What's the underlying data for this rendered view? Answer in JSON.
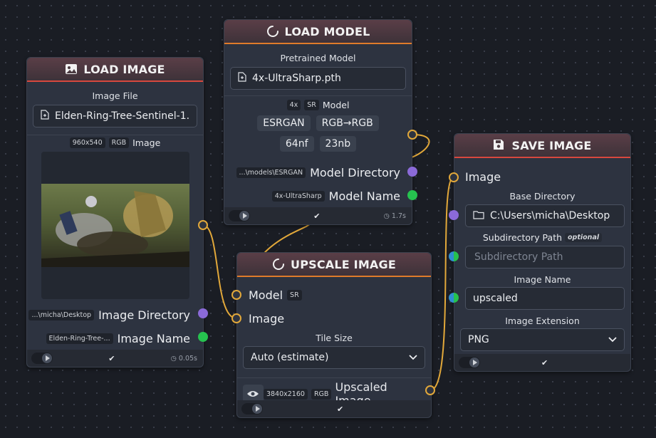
{
  "colors": {
    "canvas_bg": "#1a1d24",
    "node_bg": "#2d3340",
    "header_accent_red": "#d8483e",
    "header_accent_orange": "#e07b2a",
    "wire": "#e2a83a",
    "port_directory": "#8b6ad8",
    "port_text": "#26c24f",
    "port_image_model": "#e2a83a"
  },
  "load_image": {
    "title": "LOAD IMAGE",
    "icon": "image-icon",
    "file_label": "Image File",
    "file_value": "Elden-Ring-Tree-Sentinel-1...",
    "dims_badge": "960x540",
    "color_badge": "RGB",
    "preview_label": "Image",
    "dir_badge": "...\\micha\\Desktop",
    "dir_label": "Image Directory",
    "name_badge": "Elden-Ring-Tree-...",
    "name_label": "Image Name",
    "time": "0.05s"
  },
  "load_model": {
    "title": "LOAD MODEL",
    "icon": "loading-icon",
    "pretrained_label": "Pretrained Model",
    "pretrained_value": "4x-UltraSharp.pth",
    "scale_badge": "4x",
    "type_badge": "SR",
    "model_label": "Model",
    "chips": [
      "ESRGAN",
      "RGB→RGB",
      "64nf",
      "23nb"
    ],
    "dir_badge": "...\\models\\ESRGAN",
    "dir_label": "Model Directory",
    "name_badge": "4x-UltraSharp",
    "name_label": "Model Name",
    "time": "1.7s"
  },
  "upscale_image": {
    "title": "UPSCALE IMAGE",
    "icon": "loading-icon",
    "model_input_label": "Model",
    "model_input_badge": "SR",
    "image_input_label": "Image",
    "tile_label": "Tile Size",
    "tile_value": "Auto (estimate)",
    "out_dims_badge": "3840x2160",
    "out_color_badge": "RGB",
    "output_label": "Upscaled Image"
  },
  "save_image": {
    "title": "SAVE IMAGE",
    "icon": "floppy-icon",
    "image_input_label": "Image",
    "base_dir_label": "Base Directory",
    "base_dir_value": "C:\\Users\\micha\\Desktop",
    "subdir_label": "Subdirectory Path",
    "subdir_optional": "optional",
    "subdir_placeholder": "Subdirectory Path",
    "name_label": "Image Name",
    "name_value": "upscaled",
    "ext_label": "Image Extension",
    "ext_value": "PNG"
  }
}
